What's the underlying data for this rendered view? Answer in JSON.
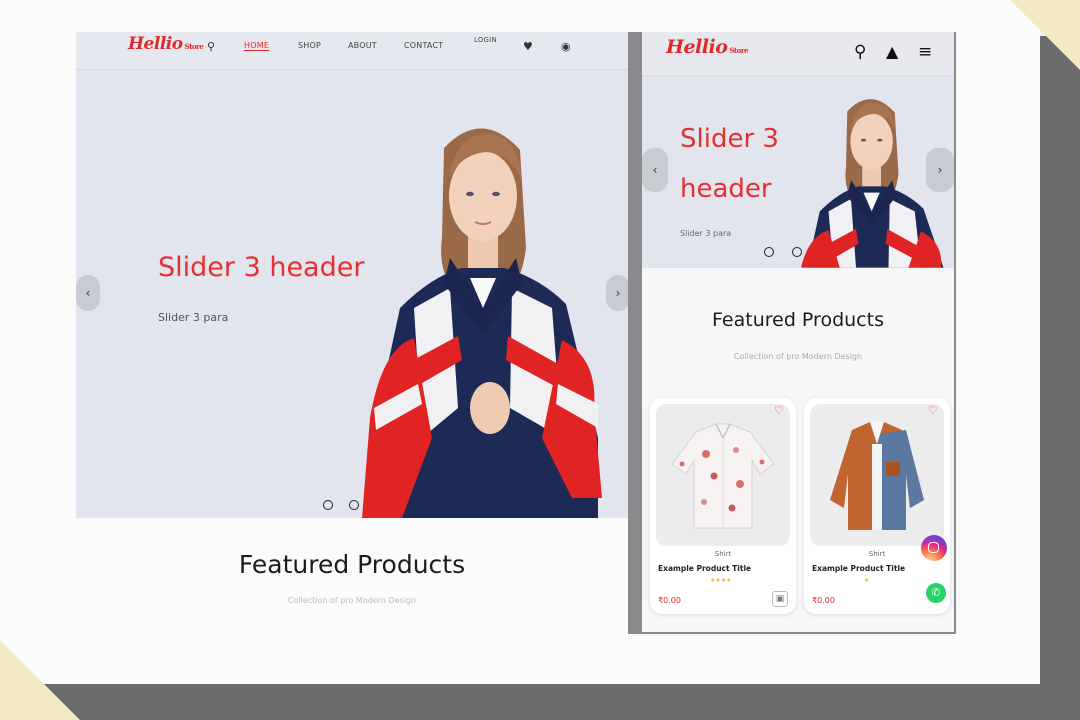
{
  "desktop": {
    "logo": "Hellio",
    "logo_suffix": "Store",
    "nav": [
      "HOME",
      "SHOP",
      "ABOUT",
      "CONTACT",
      "LOGIN"
    ],
    "slider": {
      "title": "Slider 3 header",
      "para": "Slider 3 para"
    },
    "featured_title": "Featured Products",
    "featured_sub": "Collection of pro Modern Design"
  },
  "mobile": {
    "logo": "Hellio",
    "logo_suffix": "Store",
    "slider": {
      "title": "Slider 3 header",
      "para": "Slider 3 para"
    },
    "featured_title": "Featured Products",
    "featured_sub": "Collection of pro Modern Design",
    "products": [
      {
        "category": "Shirt",
        "name": "Example Product Title",
        "price": "₹0.00"
      },
      {
        "category": "Shirt",
        "name": "Example Product Title",
        "price": "₹0.00"
      }
    ]
  },
  "colors": {
    "accent": "#e63030",
    "hero_bg": "#e2e4ee"
  }
}
